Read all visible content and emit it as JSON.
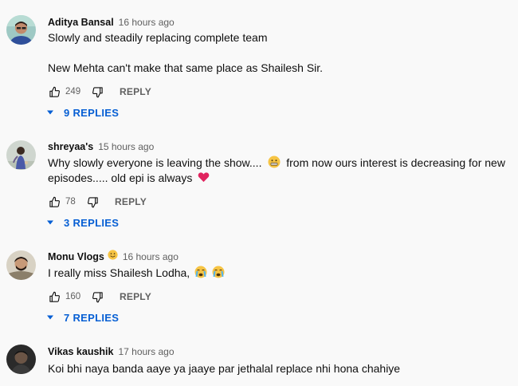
{
  "comments": [
    {
      "author": "Aditya Bansal",
      "time": "16 hours ago",
      "lines": [
        "Slowly and steadily replacing complete team",
        "New Mehta can't make that same place as Shailesh Sir."
      ],
      "likes": "249",
      "reply_label": "REPLY",
      "replies_label": "9 REPLIES"
    },
    {
      "author": "shreyaa's",
      "time": "15 hours ago",
      "lines": [
        "Why slowly everyone is leaving the show....",
        "from now ours interest is decreasing for new",
        "episodes..... old epi is always"
      ],
      "likes": "78",
      "reply_label": "REPLY",
      "replies_label": "3 REPLIES"
    },
    {
      "author": "Monu Vlogs",
      "time": "16 hours ago",
      "lines": [
        "I really miss Shailesh Lodha,"
      ],
      "likes": "160",
      "reply_label": "REPLY",
      "replies_label": "7 REPLIES"
    },
    {
      "author": "Vikas kaushik",
      "time": "17 hours ago",
      "lines": [
        "Koi bhi naya banda aaye ya jaaye par jethalal replace nhi hona chahiye"
      ]
    }
  ],
  "colors": {
    "background": "#f9f9f9",
    "link_blue": "#065fd4",
    "secondary_text": "#606060",
    "heart_red": "#e0245e"
  },
  "icons": {
    "like": "thumbs-up-icon",
    "dislike": "thumbs-down-icon",
    "expand": "caret-down-icon",
    "grimace": "grimace-emoji",
    "heart": "heart-emoji",
    "crying": "crying-emoji",
    "smile": "smile-emoji"
  }
}
